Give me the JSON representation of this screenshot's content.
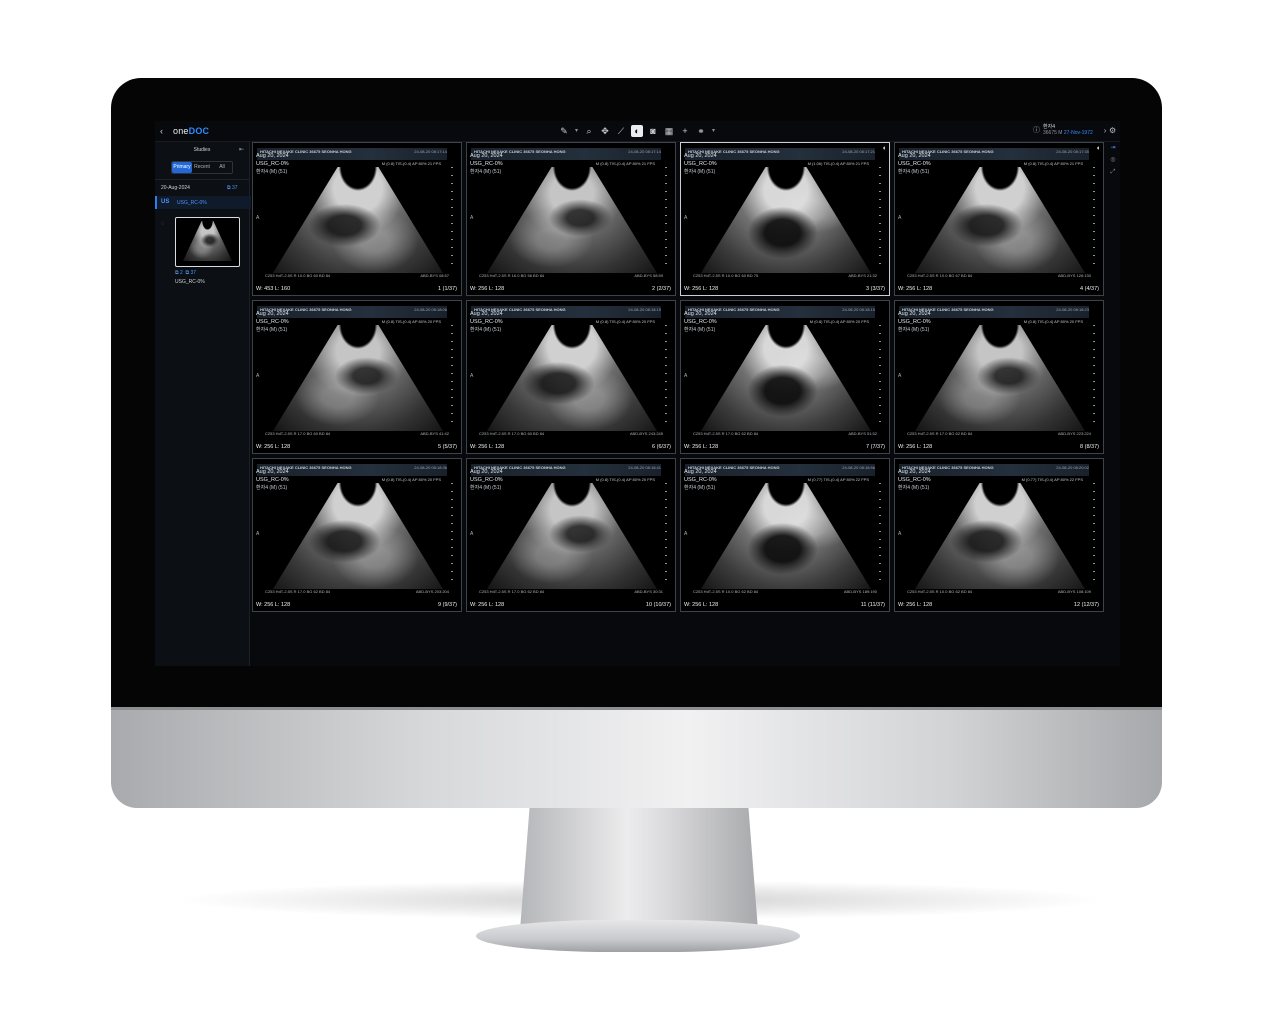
{
  "app": {
    "logo_prefix": "one",
    "logo_suffix": "DOC",
    "back_icon": "‹",
    "tools": [
      {
        "name": "pencil-tool-icon",
        "glyph": "✎"
      },
      {
        "name": "pencil-dropdown-icon",
        "glyph": "▾"
      },
      {
        "name": "zoom-icon",
        "glyph": "⌕"
      },
      {
        "name": "pan-icon",
        "glyph": "✥"
      },
      {
        "name": "measure-icon",
        "glyph": "⟋"
      },
      {
        "name": "window-level-icon",
        "glyph": "◐"
      },
      {
        "name": "camera-icon",
        "glyph": "◙"
      },
      {
        "name": "layout-icon",
        "glyph": "▦"
      },
      {
        "name": "crosshair-icon",
        "glyph": "+"
      },
      {
        "name": "link-icon",
        "glyph": "⚭"
      },
      {
        "name": "link-dropdown-icon",
        "glyph": "▾"
      }
    ],
    "patient": {
      "name": "환자4",
      "id": "36675",
      "sex": "M",
      "dob": "27-Nov-1972"
    },
    "next_icon": "›",
    "settings_icon": "⚙"
  },
  "sidebar": {
    "title": "Studies",
    "collapse_icon": "⇤",
    "tabs": [
      "Primary",
      "Recent",
      "All"
    ],
    "active_tab": "Primary",
    "study": {
      "date": "20-Aug-2024",
      "series_count": "37",
      "modality": "US",
      "description": "USG_RC-0%"
    },
    "loading_icon": "◌",
    "series": {
      "number": "2",
      "instances": "37",
      "name": "USG_RC-0%"
    }
  },
  "rail": [
    "⇥",
    "◎",
    "⤢"
  ],
  "viewports": [
    {
      "date": "Aug 20, 2024",
      "desc": "USG_RC-0%",
      "sub": "환자4 (M) (51)",
      "params": "M (0.8) TIS-(0.4) AP 80%   21 FPS",
      "wl": "W: 453  L: 160",
      "idx": "1 (1/37)",
      "time": "24-08-20 08:17:14",
      "probe": "C253 HdT-2.5S  R 10.0 BG 60  BD 84",
      "preset": "ABD-BYS 08:57",
      "variant": "v1",
      "selected": false
    },
    {
      "date": "Aug 20, 2024",
      "desc": "USG_RC-0%",
      "sub": "환자4 (M) (51)",
      "params": "M (0.8) TIS-(0.4) AP 80%   21 FPS",
      "wl": "W: 256  L: 128",
      "idx": "2 (2/37)",
      "time": "24-08-20 08:17:14",
      "probe": "C253 HdT-2.5S  R 16.0 BG 56  BD 84",
      "preset": "ABD-BYS 58:59",
      "variant": "v2",
      "selected": false
    },
    {
      "date": "Aug 20, 2024",
      "desc": "USG_RC-0%",
      "sub": "환자4 (M) (51)",
      "params": "M (1.06) TIS-(0.4) AP 80%   21 FPS",
      "wl": "W: 256  L: 128",
      "idx": "3 (3/37)",
      "time": "24-08-20 08:17:21",
      "probe": "C253 HdT-2.5S  R 10.0 BG 60  BD 75",
      "preset": "ABD-BYS 21:32",
      "variant": "v3",
      "selected": true
    },
    {
      "date": "Aug 20, 2024",
      "desc": "USG_RC-0%",
      "sub": "환자4 (M) (51)",
      "params": "M (0.8) TIS-(0.4) AP 80%   21 FPS",
      "wl": "W: 256  L: 128",
      "idx": "4 (4/37)",
      "time": "24-08-20 08:17:35",
      "probe": "C253 HdT-2.5S  R 10.0 BG 67  BD 84",
      "preset": "ABD-BYS 126:130",
      "variant": "v1",
      "selected": false
    },
    {
      "date": "Aug 20, 2024",
      "desc": "USG_RC-0%",
      "sub": "환자4 (M) (51)",
      "params": "M (0.8) TIS-(0.4) AP 80%   20 FPS",
      "wl": "W: 256  L: 128",
      "idx": "5 (5/37)",
      "time": "24-08-20 08:18:06",
      "probe": "C253 HdT-2.5S  R 17.0 BG 60  BD 84",
      "preset": "ABD-BYS 41:42",
      "variant": "v2",
      "selected": false
    },
    {
      "date": "Aug 20, 2024",
      "desc": "USG_RC-0%",
      "sub": "환자4 (M) (51)",
      "params": "M (0.8) TIS-(0.4) AP 80%   20 FPS",
      "wl": "W: 256  L: 128",
      "idx": "6 (6/37)",
      "time": "24-08-20 08:18:15",
      "probe": "C253 HdT-2.5S  R 17.0 BG 60  BD 84",
      "preset": "ABD-BYS 243:245",
      "variant": "v1",
      "selected": false
    },
    {
      "date": "Aug 20, 2024",
      "desc": "USG_RC-0%",
      "sub": "환자4 (M) (51)",
      "params": "M (0.8) TIS-(0.4) AP 80%   20 FPS",
      "wl": "W: 256  L: 128",
      "idx": "7 (7/37)",
      "time": "24-08-20 08:18:15",
      "probe": "C253 HdT-2.5S  R 17.0 BG 62  BD 84",
      "preset": "ABD-BYS 51:52",
      "variant": "v3",
      "selected": false
    },
    {
      "date": "Aug 20, 2024",
      "desc": "USG_RC-0%",
      "sub": "환자4 (M) (51)",
      "params": "M (0.8) TIS-(0.4) AP 80%   20 FPS",
      "wl": "W: 256  L: 128",
      "idx": "8 (8/37)",
      "time": "24-08-20 08:18:23",
      "probe": "C253 HdT-2.5S  R 17.0 BG 62  BD 84",
      "preset": "ABD-BYS 223:224",
      "variant": "v2",
      "selected": false
    },
    {
      "date": "Aug 20, 2024",
      "desc": "USG_RC-0%",
      "sub": "환자4 (M) (51)",
      "params": "M (0.8) TIS-(0.4) AP 80%   20 FPS",
      "wl": "W: 256  L: 128",
      "idx": "9 (9/37)",
      "time": "24-08-20 08:18:36",
      "probe": "C253 HdT-2.5S  R 17.0 BG 62  BD 84",
      "preset": "ABD-BYS 203:204",
      "variant": "v1",
      "selected": false
    },
    {
      "date": "Aug 20, 2024",
      "desc": "USG_RC-0%",
      "sub": "환자4 (M) (51)",
      "params": "M (0.8) TIS-(0.4) AP 80%   20 FPS",
      "wl": "W: 256  L: 128",
      "idx": "10 (10/37)",
      "time": "24-08-20 08:18:41",
      "probe": "C253 HdT-2.5S  R 17.0 BG 62  BD 84",
      "preset": "ABD-BYS 30:31",
      "variant": "v2",
      "selected": false
    },
    {
      "date": "Aug 20, 2024",
      "desc": "USG_RC-0%",
      "sub": "환자4 (M) (51)",
      "params": "M (0.77) TIS-(0.4) AP 80%   22 FPS",
      "wl": "W: 256  L: 128",
      "idx": "11 (11/37)",
      "time": "24-08-20 08:18:56",
      "probe": "C253 HdT-2.5S  R 10.0 BG 62  BD 84",
      "preset": "ABD-BYS 189:190",
      "variant": "v3",
      "selected": false
    },
    {
      "date": "Aug 20, 2024",
      "desc": "USG_RC-0%",
      "sub": "환자4 (M) (51)",
      "params": "M (0.77) TIS-(0.4) AP 80%   22 FPS",
      "wl": "W: 256  L: 128",
      "idx": "12 (12/37)",
      "time": "24-08-20 08:20:02",
      "probe": "C253 HdT-2.5S  R 10.0 BG 62  BD 84",
      "preset": "ABD-BYS 108:109",
      "variant": "v1",
      "selected": false
    }
  ],
  "viewport_common": {
    "brand": "HITACHI  NEXAKE CLINIC      36675  SEONHA HONG",
    "marker": "A",
    "cycle_icon": "◐"
  },
  "colors": {
    "accent": "#2468d8",
    "link_blue": "#4f95ff",
    "background": "#07090c"
  }
}
